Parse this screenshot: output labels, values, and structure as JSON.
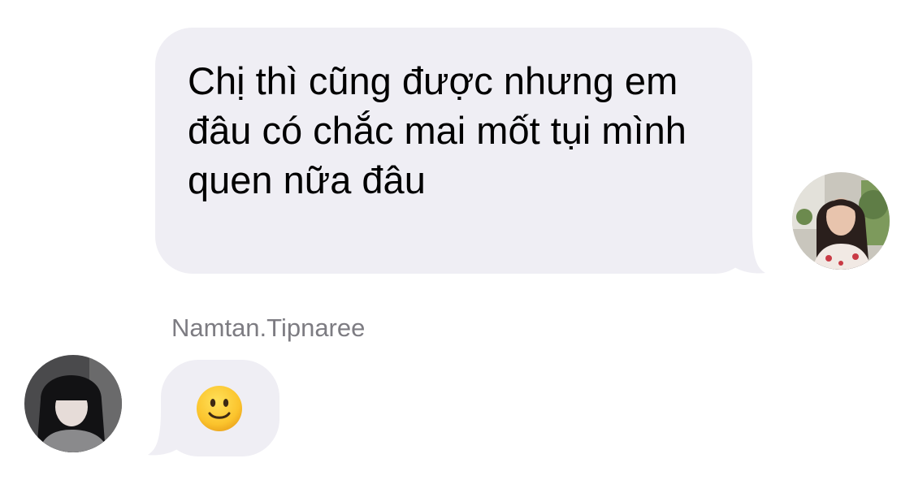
{
  "conversation": {
    "outgoing_message": {
      "text": "Chị thì cũng được nhưng em đâu có chắc mai mốt tụi mình quen nữa đâu",
      "bubble_color": "#efeef4"
    },
    "incoming_message": {
      "sender_name": "Namtan.Tipnaree",
      "content": "slightly-smiling-face-emoji",
      "bubble_color": "#efeef4"
    },
    "sender_name_color": "#7d7c82"
  },
  "avatars": {
    "self": "avatar-photo-woman-long-hair",
    "other": "avatar-photo-woman-bangs"
  }
}
